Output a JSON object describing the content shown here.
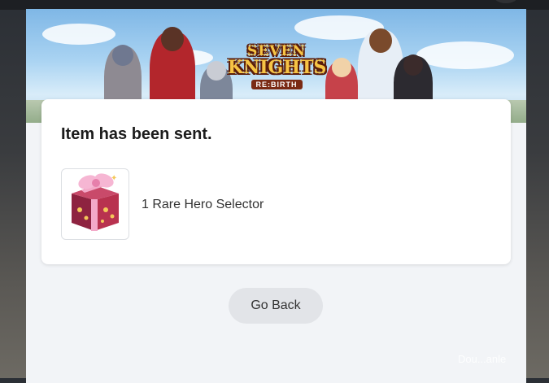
{
  "banner": {
    "logo_line1": "SEVEN",
    "logo_line2": "KNIGHTS",
    "logo_line3": "RE:BIRTH"
  },
  "card": {
    "title": "Item has been sent.",
    "item": {
      "name": "1 Rare Hero Selector",
      "icon": "gift-box-icon"
    }
  },
  "actions": {
    "go_back_label": "Go Back"
  },
  "watermark": {
    "text": "Dou...anle"
  },
  "colors": {
    "card_background": "#ffffff",
    "modal_background": "#f2f4f7",
    "button_background": "#e2e4e8",
    "title_text": "#1c1c1c"
  }
}
